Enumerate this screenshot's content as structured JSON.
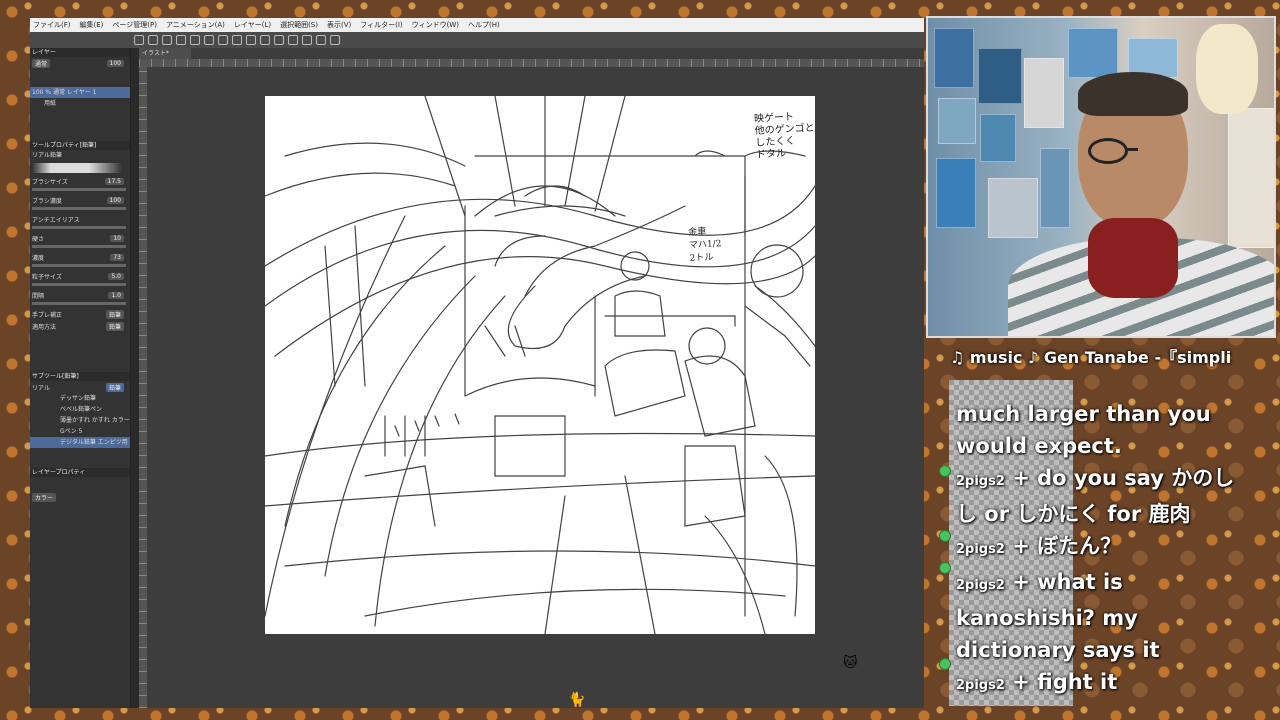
{
  "app": {
    "menu": [
      "ファイル(F)",
      "編集(E)",
      "ページ管理(P)",
      "アニメーション(A)",
      "レイヤー(L)",
      "選択範囲(S)",
      "表示(V)",
      "フィルター(I)",
      "ウィンドウ(W)",
      "ヘルプ(H)"
    ],
    "layer_panel": {
      "title": "レイヤー",
      "blend_mode": "通常",
      "opacity": "100",
      "layers": [
        {
          "label": "100 % 通常 レイヤー 1",
          "selected": true
        },
        {
          "label": "用紙",
          "selected": false
        }
      ]
    },
    "tool_property": {
      "title": "ツールプロパティ[鉛筆]",
      "tool_name": "リアル鉛筆",
      "rows": [
        {
          "label": "ブラシサイズ",
          "value": "17.5"
        },
        {
          "label": "ブラシ濃度",
          "value": "100"
        },
        {
          "label": "アンチエイリアス",
          "value": ""
        },
        {
          "label": "硬さ",
          "value": "10"
        },
        {
          "label": "濃度",
          "value": "73"
        },
        {
          "label": "粒子サイズ",
          "value": "5.0"
        },
        {
          "label": "間隔",
          "value": "1.0"
        },
        {
          "label": "手ブレ補正",
          "value": "鉛筆"
        },
        {
          "label": "適用方法",
          "value": "鉛筆"
        }
      ]
    },
    "sub_tool": {
      "title": "サブツール[鉛筆]",
      "tabs": [
        "リアル",
        "鉛筆"
      ],
      "brushes": [
        "デッサン鉛筆",
        "ベベル鉛筆ペン",
        "薄墨かすれ かすれ カラー",
        "Gペン 5",
        "デジタル鉛筆 エンピツ用"
      ]
    },
    "layer_property": {
      "title": "レイヤープロパティ",
      "color_label": "カラー"
    },
    "canvas_tab": "イラスト*"
  },
  "canvas_notes": {
    "top_right": "映ゲート\n他のゲンゴとか\nしたくく\nドタル",
    "middle": "金車\nマハ1/2\n2トル"
  },
  "overlay": {
    "music": "♫ music ♪ Gen  Tanabe -『simpli",
    "chat": [
      {
        "user": "",
        "text": "much larger than you would expect."
      },
      {
        "user": "2pigs2",
        "text": "do you say かのしし or しかにく for 鹿肉"
      },
      {
        "user": "2pigs2",
        "text": "ぼたん？"
      },
      {
        "user": "2pigs2",
        "text": "what is kanoshishi? my dictionary says it"
      },
      {
        "user": "2pigs2",
        "text": "fight it"
      }
    ]
  },
  "colors": {
    "ui_dark": "#3d3d3d",
    "menu_bg": "#f0f0f0",
    "selection": "#4e6a9a",
    "chat_badge": "#49c35b",
    "stream_bg": "#6b4428"
  }
}
